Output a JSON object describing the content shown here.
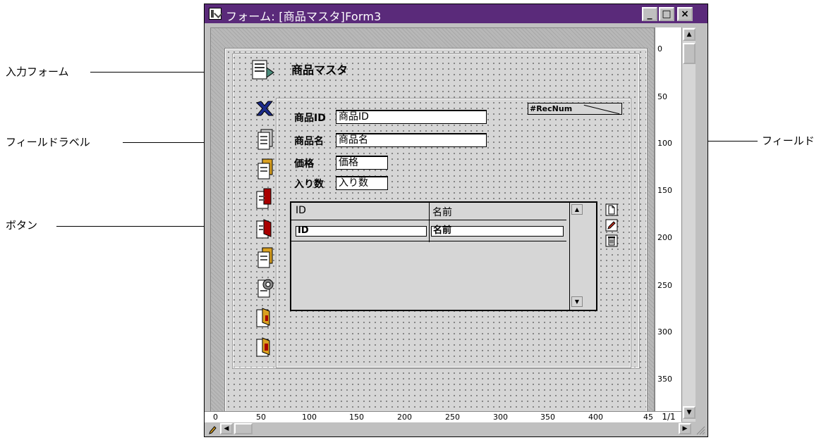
{
  "callouts": {
    "input_form": "入力フォーム",
    "field_label": "フィールドラベル",
    "button": "ボタン",
    "field": "フィールド"
  },
  "window": {
    "title": "フォーム: [商品マスタ]Form3",
    "minimize": "_",
    "maximize": "□",
    "close": "×"
  },
  "form": {
    "title": "商品マスタ",
    "recnum": "#RecNum",
    "fields": [
      {
        "label": "商品ID",
        "value": "商品ID"
      },
      {
        "label": "商品名",
        "value": "商品名"
      },
      {
        "label": "価格",
        "value": "価格"
      },
      {
        "label": "入り数",
        "value": "入り数"
      }
    ],
    "subform": {
      "columns": [
        "ID",
        "名前"
      ],
      "row": [
        "ID",
        "名前"
      ]
    }
  },
  "vruler": [
    "0",
    "50",
    "100",
    "150",
    "200",
    "250",
    "300",
    "350"
  ],
  "hruler": [
    "0",
    "50",
    "100",
    "150",
    "200",
    "250",
    "300",
    "350",
    "400",
    "45"
  ],
  "page_indicator": "1/1",
  "colors": {
    "titlebar": "#5a2a7a",
    "delete_icon": "#1a2a8a",
    "door_icon": "#aa0000"
  },
  "icons": {
    "form_icon": "form-icon",
    "tools": [
      "delete-icon",
      "first-record-icon",
      "prev-record-icon",
      "next-record-icon",
      "last-record-icon",
      "add-record-icon",
      "print-icon",
      "save-exit-icon",
      "cancel-exit-icon"
    ],
    "subform_tools": [
      "new-document-icon",
      "edit-pencil-icon",
      "trash-icon"
    ]
  }
}
